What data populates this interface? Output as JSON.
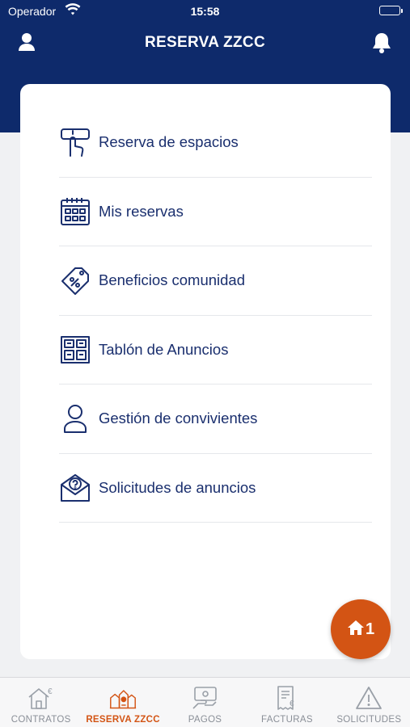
{
  "status_bar": {
    "carrier": "Operador",
    "time": "15:58"
  },
  "header": {
    "title": "RESERVA ZZCC",
    "left_icon": "user-icon",
    "right_icon": "bell-icon"
  },
  "menu": [
    {
      "label": "Reserva de espacios",
      "icon": "hand-touch-icon"
    },
    {
      "label": "Mis reservas",
      "icon": "calendar-icon"
    },
    {
      "label": "Beneficios comunidad",
      "icon": "discount-tag-icon"
    },
    {
      "label": "Tablón de Anuncios",
      "icon": "notice-board-icon"
    },
    {
      "label": "Gestión de convivientes",
      "icon": "person-icon"
    },
    {
      "label": "Solicitudes de anuncios",
      "icon": "envelope-question-icon"
    }
  ],
  "fab": {
    "count": "1",
    "icon": "home-icon"
  },
  "tabs": [
    {
      "label": "CONTRATOS",
      "icon": "house-euro-icon",
      "active": false
    },
    {
      "label": "RESERVA ZZCC",
      "icon": "community-icon",
      "active": true
    },
    {
      "label": "PAGOS",
      "icon": "payment-icon",
      "active": false
    },
    {
      "label": "FACTURAS",
      "icon": "invoice-icon",
      "active": false
    },
    {
      "label": "SOLICITUDES",
      "icon": "warning-icon",
      "active": false
    }
  ],
  "colors": {
    "header": "#0e2a6b",
    "accent": "#d35414",
    "text": "#1a2f6e",
    "inactive_tab": "#8a8f97"
  }
}
